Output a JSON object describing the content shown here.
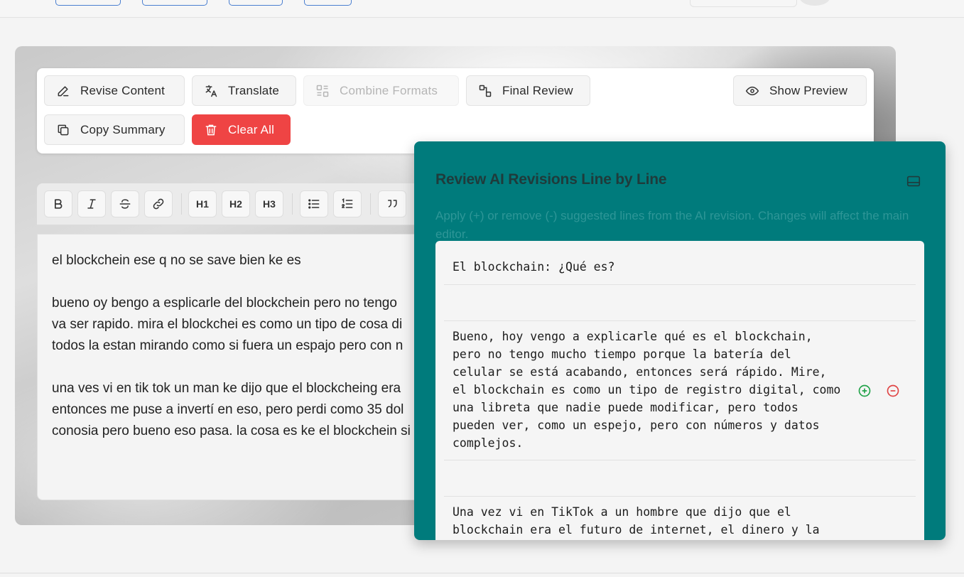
{
  "toolbar": {
    "revise": "Revise Content",
    "translate": "Translate",
    "combine": "Combine Formats",
    "final_review": "Final Review",
    "show_preview": "Show Preview",
    "copy_summary": "Copy Summary",
    "clear_all": "Clear All"
  },
  "format_toolbar": {
    "h1": "H1",
    "h2": "H2",
    "h3": "H3"
  },
  "editor": {
    "lines": [
      "el blockchein ese q no se save bien ke es",
      "bueno oy bengo a esplicarle del blockchein pero no tengo",
      "va ser rapido. mira el blockchei es como un tipo de cosa di",
      "todos la estan mirando como si fuera un espajo pero con n",
      "una ves vi en tik tok un man ke dijo que el blockcheing era",
      "entonces me puse a invertí en eso, pero perdi como 35 dol",
      "conosia pero bueno eso pasa. la cosa es ke el blockchein si"
    ]
  },
  "review": {
    "title": "Review AI Revisions Line by Line",
    "subtitle": "Apply (+) or remove (-) suggested lines from the AI revision. Changes will affect the main editor.",
    "lines": [
      "El blockchain: ¿Qué es?",
      "",
      "Bueno, hoy vengo a explicarle qué es el blockchain,\npero no tengo mucho tiempo porque la batería del\ncelular se está acabando, entonces será rápido. Mire,\nel blockchain es como un tipo de registro digital, como\nuna libreta que nadie puede modificar, pero todos\npueden ver, como un espejo, pero con números y datos\ncomplejos.",
      "",
      "Una vez vi en TikTok a un hombre que dijo que el\nblockchain era el futuro de internet, el dinero y la"
    ]
  },
  "colors": {
    "review_bg": "#007b7c",
    "danger": "#ef4444",
    "apply_green": "#22a34a",
    "remove_red": "#e04444"
  }
}
